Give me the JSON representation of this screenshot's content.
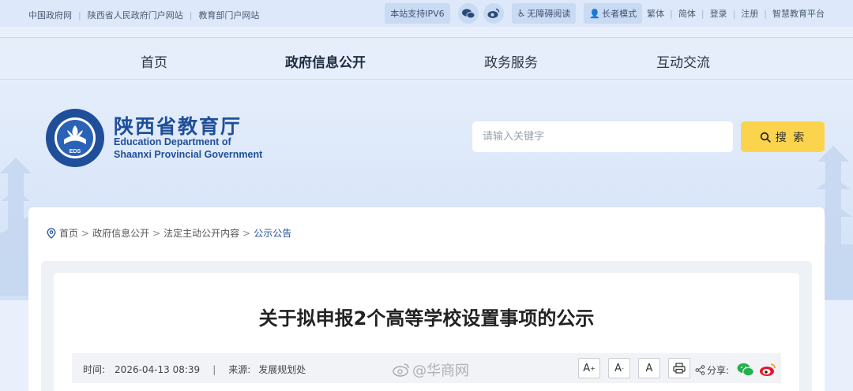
{
  "topbar": {
    "links": [
      "中国政府网",
      "陕西省人民政府门户网站",
      "教育部门户网站"
    ],
    "ipv6": "本站支持IPV6",
    "accessibility": "无障碍阅读",
    "elder_mode": "长者模式",
    "traditional": "繁体",
    "simplified": "简体",
    "login": "登录",
    "register": "注册",
    "platform": "智慧教育平台"
  },
  "nav": {
    "items": [
      "首页",
      "政府信息公开",
      "政务服务",
      "互动交流"
    ],
    "active_index": 1
  },
  "logo": {
    "name_cn": "陕西省教育厅",
    "name_en_line1": "Education Department of",
    "name_en_line2": "Shaanxi Provincial Government",
    "emblem_text": "EDS"
  },
  "search": {
    "placeholder": "请输入关键字",
    "button": "搜 索"
  },
  "breadcrumb": {
    "items": [
      "首页",
      "政府信息公开",
      "法定主动公开内容",
      "公示公告"
    ]
  },
  "article": {
    "title": "关于拟申报2个高等学校设置事项的公示",
    "time_label": "时间:",
    "time": "2026-04-13 08:39",
    "source_label": "来源:",
    "source": "发展规划处",
    "font_large": "A",
    "font_medium": "A",
    "font_small": "A",
    "share_label": "分享:"
  },
  "watermark": "@华商网",
  "colors": {
    "brand_blue": "#1f4f9a",
    "search_button": "#fcd34d",
    "topbar_bg": "#dde9fa"
  }
}
